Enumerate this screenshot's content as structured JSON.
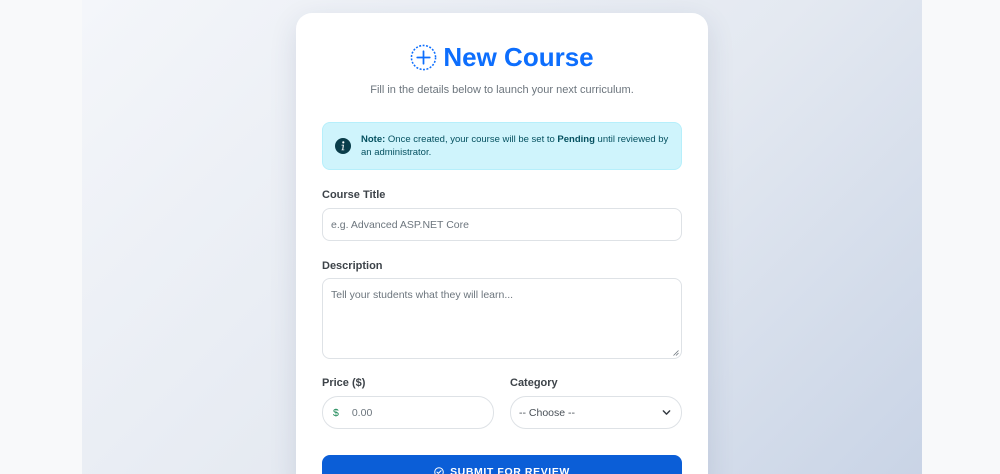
{
  "header": {
    "title": "New Course",
    "subtitle": "Fill in the details below to launch your next curriculum."
  },
  "note": {
    "label": "Note:",
    "text_before": " Once created, your course will be set to ",
    "status": "Pending",
    "text_after": " until reviewed by an administrator."
  },
  "form": {
    "course_title": {
      "label": "Course Title",
      "placeholder": "e.g. Advanced ASP.NET Core"
    },
    "description": {
      "label": "Description",
      "placeholder": "Tell your students what they will learn..."
    },
    "price": {
      "label": "Price ($)",
      "currency_symbol": "$",
      "placeholder": "0.00"
    },
    "category": {
      "label": "Category",
      "selected": "-- Choose --"
    },
    "submit_label": "SUBMIT FOR REVIEW"
  },
  "colors": {
    "accent": "#0d6efd",
    "button": "#0b5ed7",
    "note_bg": "#cff4fc",
    "note_text": "#055160",
    "currency": "#198754"
  },
  "icons": {
    "title": "plus-circle-icon",
    "note": "info-circle-icon",
    "submit": "check-circle-icon",
    "select": "chevron-down-icon"
  }
}
